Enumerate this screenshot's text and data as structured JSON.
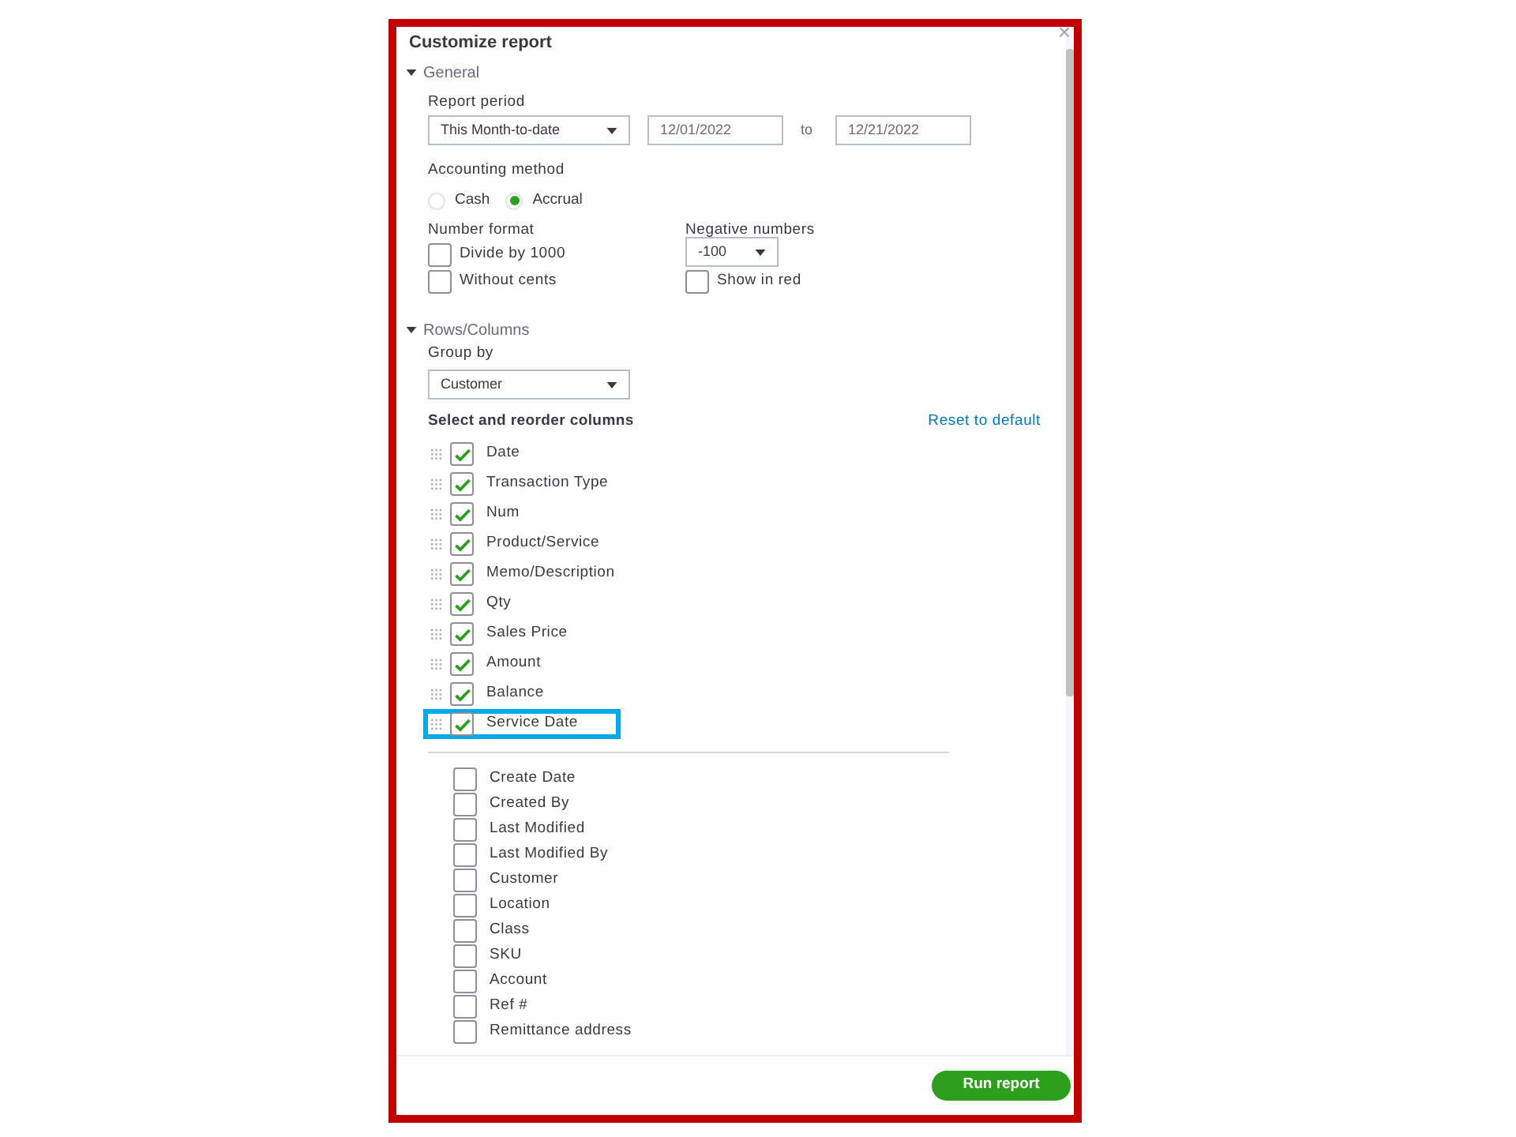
{
  "title": "Customize report",
  "close": "×",
  "general": {
    "label": "General",
    "expanded": true,
    "report_period": {
      "label": "Report period",
      "value": "This Month-to-date",
      "from": "12/01/2022",
      "to_label": "to",
      "to": "12/21/2022"
    },
    "accounting_method": {
      "label": "Accounting method",
      "options": [
        {
          "label": "Cash",
          "selected": false
        },
        {
          "label": "Accrual",
          "selected": true
        }
      ]
    },
    "number_format": {
      "label": "Number format",
      "options": [
        {
          "label": "Divide by 1000",
          "checked": false
        },
        {
          "label": "Without cents",
          "checked": false
        }
      ]
    },
    "negative_numbers": {
      "label": "Negative numbers",
      "value": "-100",
      "show_in_red": {
        "label": "Show in red",
        "checked": false
      }
    }
  },
  "rows_columns": {
    "label": "Rows/Columns",
    "expanded": true,
    "group_by": {
      "label": "Group by",
      "value": "Customer"
    },
    "columns_label": "Select and reorder columns",
    "reset_link": "Reset to default",
    "selected_columns": [
      {
        "label": "Date",
        "checked": true,
        "highlighted": false
      },
      {
        "label": "Transaction Type",
        "checked": true,
        "highlighted": false
      },
      {
        "label": "Num",
        "checked": true,
        "highlighted": false
      },
      {
        "label": "Product/Service",
        "checked": true,
        "highlighted": false
      },
      {
        "label": "Memo/Description",
        "checked": true,
        "highlighted": false
      },
      {
        "label": "Qty",
        "checked": true,
        "highlighted": false
      },
      {
        "label": "Sales Price",
        "checked": true,
        "highlighted": false
      },
      {
        "label": "Amount",
        "checked": true,
        "highlighted": false
      },
      {
        "label": "Balance",
        "checked": true,
        "highlighted": false
      },
      {
        "label": "Service Date",
        "checked": true,
        "highlighted": true
      }
    ],
    "other_columns": [
      {
        "label": "Create Date",
        "checked": false
      },
      {
        "label": "Created By",
        "checked": false
      },
      {
        "label": "Last Modified",
        "checked": false
      },
      {
        "label": "Last Modified By",
        "checked": false
      },
      {
        "label": "Customer",
        "checked": false
      },
      {
        "label": "Location",
        "checked": false
      },
      {
        "label": "Class",
        "checked": false
      },
      {
        "label": "SKU",
        "checked": false
      },
      {
        "label": "Account",
        "checked": false
      },
      {
        "label": "Ref #",
        "checked": false
      },
      {
        "label": "Remittance address",
        "checked": false
      }
    ]
  },
  "run_button": "Run report"
}
